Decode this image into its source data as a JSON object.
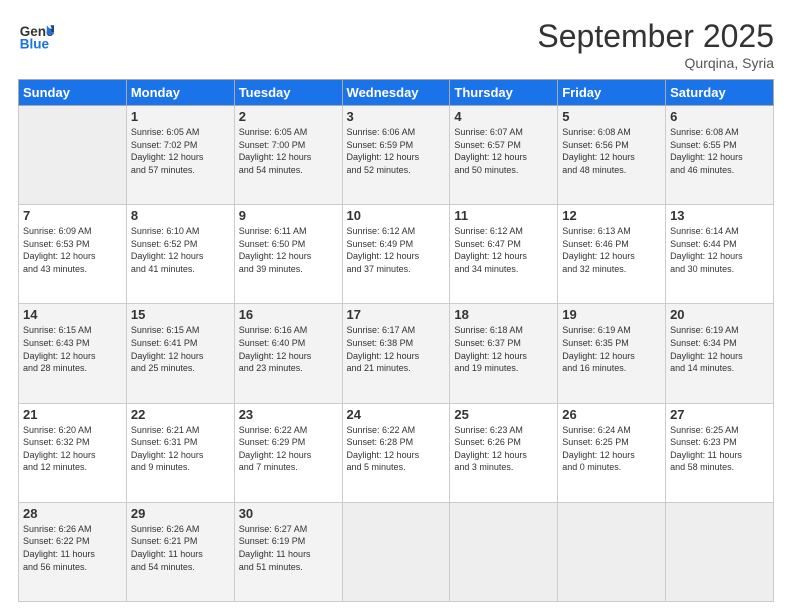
{
  "logo": {
    "line1": "General",
    "line2": "Blue"
  },
  "title": "September 2025",
  "subtitle": "Qurqina, Syria",
  "days_header": [
    "Sunday",
    "Monday",
    "Tuesday",
    "Wednesday",
    "Thursday",
    "Friday",
    "Saturday"
  ],
  "weeks": [
    [
      {
        "day": "",
        "info": ""
      },
      {
        "day": "1",
        "info": "Sunrise: 6:05 AM\nSunset: 7:02 PM\nDaylight: 12 hours\nand 57 minutes."
      },
      {
        "day": "2",
        "info": "Sunrise: 6:05 AM\nSunset: 7:00 PM\nDaylight: 12 hours\nand 54 minutes."
      },
      {
        "day": "3",
        "info": "Sunrise: 6:06 AM\nSunset: 6:59 PM\nDaylight: 12 hours\nand 52 minutes."
      },
      {
        "day": "4",
        "info": "Sunrise: 6:07 AM\nSunset: 6:57 PM\nDaylight: 12 hours\nand 50 minutes."
      },
      {
        "day": "5",
        "info": "Sunrise: 6:08 AM\nSunset: 6:56 PM\nDaylight: 12 hours\nand 48 minutes."
      },
      {
        "day": "6",
        "info": "Sunrise: 6:08 AM\nSunset: 6:55 PM\nDaylight: 12 hours\nand 46 minutes."
      }
    ],
    [
      {
        "day": "7",
        "info": "Sunrise: 6:09 AM\nSunset: 6:53 PM\nDaylight: 12 hours\nand 43 minutes."
      },
      {
        "day": "8",
        "info": "Sunrise: 6:10 AM\nSunset: 6:52 PM\nDaylight: 12 hours\nand 41 minutes."
      },
      {
        "day": "9",
        "info": "Sunrise: 6:11 AM\nSunset: 6:50 PM\nDaylight: 12 hours\nand 39 minutes."
      },
      {
        "day": "10",
        "info": "Sunrise: 6:12 AM\nSunset: 6:49 PM\nDaylight: 12 hours\nand 37 minutes."
      },
      {
        "day": "11",
        "info": "Sunrise: 6:12 AM\nSunset: 6:47 PM\nDaylight: 12 hours\nand 34 minutes."
      },
      {
        "day": "12",
        "info": "Sunrise: 6:13 AM\nSunset: 6:46 PM\nDaylight: 12 hours\nand 32 minutes."
      },
      {
        "day": "13",
        "info": "Sunrise: 6:14 AM\nSunset: 6:44 PM\nDaylight: 12 hours\nand 30 minutes."
      }
    ],
    [
      {
        "day": "14",
        "info": "Sunrise: 6:15 AM\nSunset: 6:43 PM\nDaylight: 12 hours\nand 28 minutes."
      },
      {
        "day": "15",
        "info": "Sunrise: 6:15 AM\nSunset: 6:41 PM\nDaylight: 12 hours\nand 25 minutes."
      },
      {
        "day": "16",
        "info": "Sunrise: 6:16 AM\nSunset: 6:40 PM\nDaylight: 12 hours\nand 23 minutes."
      },
      {
        "day": "17",
        "info": "Sunrise: 6:17 AM\nSunset: 6:38 PM\nDaylight: 12 hours\nand 21 minutes."
      },
      {
        "day": "18",
        "info": "Sunrise: 6:18 AM\nSunset: 6:37 PM\nDaylight: 12 hours\nand 19 minutes."
      },
      {
        "day": "19",
        "info": "Sunrise: 6:19 AM\nSunset: 6:35 PM\nDaylight: 12 hours\nand 16 minutes."
      },
      {
        "day": "20",
        "info": "Sunrise: 6:19 AM\nSunset: 6:34 PM\nDaylight: 12 hours\nand 14 minutes."
      }
    ],
    [
      {
        "day": "21",
        "info": "Sunrise: 6:20 AM\nSunset: 6:32 PM\nDaylight: 12 hours\nand 12 minutes."
      },
      {
        "day": "22",
        "info": "Sunrise: 6:21 AM\nSunset: 6:31 PM\nDaylight: 12 hours\nand 9 minutes."
      },
      {
        "day": "23",
        "info": "Sunrise: 6:22 AM\nSunset: 6:29 PM\nDaylight: 12 hours\nand 7 minutes."
      },
      {
        "day": "24",
        "info": "Sunrise: 6:22 AM\nSunset: 6:28 PM\nDaylight: 12 hours\nand 5 minutes."
      },
      {
        "day": "25",
        "info": "Sunrise: 6:23 AM\nSunset: 6:26 PM\nDaylight: 12 hours\nand 3 minutes."
      },
      {
        "day": "26",
        "info": "Sunrise: 6:24 AM\nSunset: 6:25 PM\nDaylight: 12 hours\nand 0 minutes."
      },
      {
        "day": "27",
        "info": "Sunrise: 6:25 AM\nSunset: 6:23 PM\nDaylight: 11 hours\nand 58 minutes."
      }
    ],
    [
      {
        "day": "28",
        "info": "Sunrise: 6:26 AM\nSunset: 6:22 PM\nDaylight: 11 hours\nand 56 minutes."
      },
      {
        "day": "29",
        "info": "Sunrise: 6:26 AM\nSunset: 6:21 PM\nDaylight: 11 hours\nand 54 minutes."
      },
      {
        "day": "30",
        "info": "Sunrise: 6:27 AM\nSunset: 6:19 PM\nDaylight: 11 hours\nand 51 minutes."
      },
      {
        "day": "",
        "info": ""
      },
      {
        "day": "",
        "info": ""
      },
      {
        "day": "",
        "info": ""
      },
      {
        "day": "",
        "info": ""
      }
    ]
  ]
}
